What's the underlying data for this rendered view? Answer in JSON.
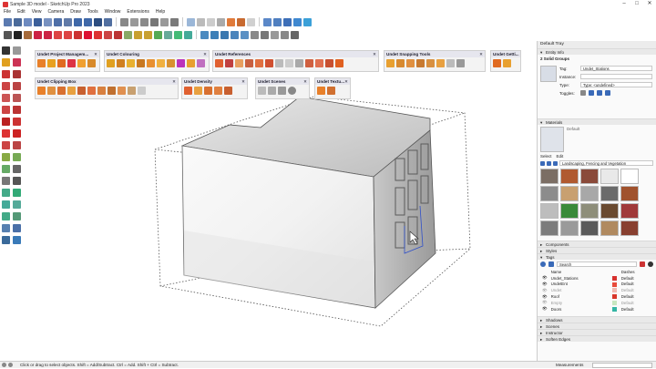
{
  "window": {
    "title": "Sample 3D model - SketchUp Pro 2023",
    "controls": [
      "–",
      "□",
      "✕"
    ]
  },
  "menu": [
    "File",
    "Edit",
    "View",
    "Camera",
    "Draw",
    "Tools",
    "Window",
    "Extensions",
    "Help"
  ],
  "toolbars": {
    "project_management": {
      "title": "Undet Project Managem...",
      "close": "✕"
    },
    "colouring": {
      "title": "Undet Colouring",
      "close": "✕"
    },
    "references": {
      "title": "Undet References",
      "close": "✕"
    },
    "snapping": {
      "title": "Undet Snapping Tools",
      "close": "✕"
    },
    "getting": {
      "title": "Undet Getti...",
      "close": "✕"
    },
    "clipping": {
      "title": "Undet Clipping Box",
      "close": "✕"
    },
    "density": {
      "title": "Undet Density",
      "close": "✕"
    },
    "scenes": {
      "title": "Undet Scenes",
      "close": "✕"
    },
    "texture": {
      "title": "Undet Textu...",
      "close": "✕"
    }
  },
  "tray": {
    "title": "Default Tray",
    "entity_info": {
      "header": "Entity Info",
      "count": "2 Solid Groups",
      "tag_label": "Tag:",
      "tag_value": "Undet_Stations",
      "instance_label": "Instance:",
      "type_label": "Type:",
      "type_value": "Type: <undefined>",
      "toggles_label": "Toggles:"
    },
    "materials": {
      "header": "Materials",
      "name": "Default",
      "tabs": [
        "Select",
        "Edit"
      ],
      "collection": "Landscaping, Fencing and Vegetation"
    },
    "components": "Components",
    "styles": "Styles",
    "tags": {
      "header": "Tags",
      "search_placeholder": "Search",
      "col_name": "Name",
      "col_dashes": "Dashes",
      "rows": [
        {
          "name": "Undet_Stations",
          "dashes": "Default",
          "color": "#d7312e"
        },
        {
          "name": "UndetEnt",
          "dashes": "Default",
          "color": "#e84a3a"
        },
        {
          "name": "Undet",
          "dashes": "Default",
          "color": "#f1b8b0"
        },
        {
          "name": "Roof",
          "dashes": "Default",
          "color": "#d9362a"
        },
        {
          "name": "Empty",
          "dashes": "Default",
          "color": "#c8e6c0"
        },
        {
          "name": "Doors",
          "dashes": "Default",
          "color": "#34b5a4"
        }
      ]
    },
    "collapsed": [
      "Shadows",
      "Scenes",
      "Instructor",
      "Soften Edges"
    ]
  },
  "status": {
    "hint": "Click or drag to select objects. Shift = Add/Subtract. Ctrl = Add. Shift + Ctrl = Subtract.",
    "measurements_label": "Measurements"
  },
  "colors": {
    "accent": "#1a73e8",
    "tag_red": "#d7312e",
    "icon_orange": "#e8802a"
  }
}
